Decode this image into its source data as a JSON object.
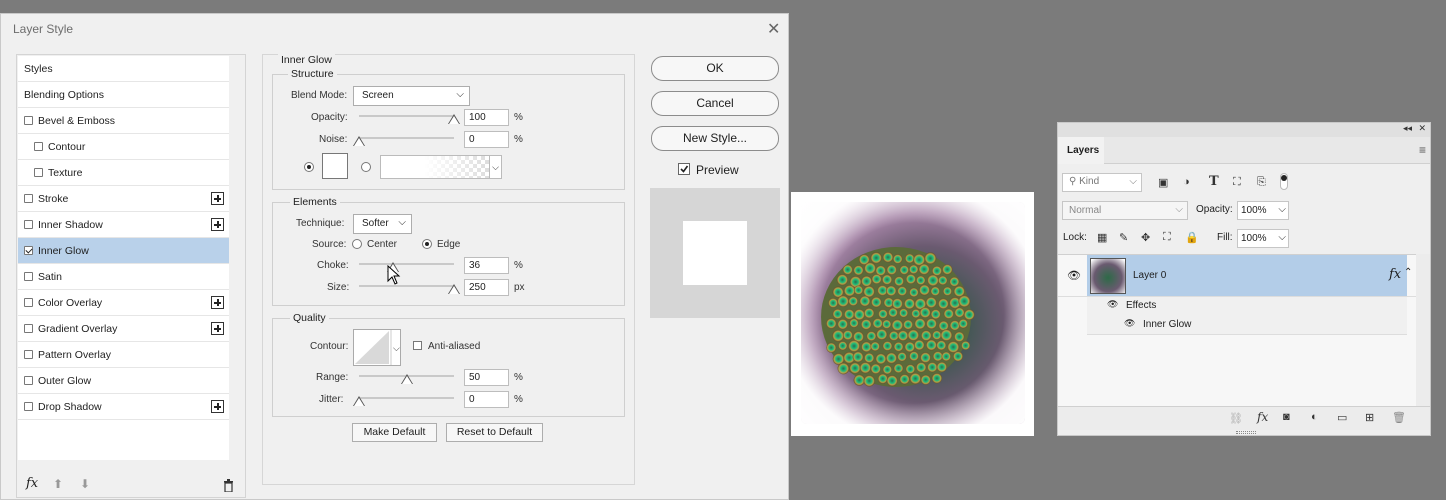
{
  "dialog": {
    "title": "Layer Style",
    "close_glyph": "✕",
    "styles_list": [
      {
        "label": "Styles",
        "checkbox": false,
        "checked": false,
        "plus": false,
        "indent": false
      },
      {
        "label": "Blending Options",
        "checkbox": false,
        "checked": false,
        "plus": false,
        "indent": false
      },
      {
        "label": "Bevel & Emboss",
        "checkbox": true,
        "checked": false,
        "plus": false,
        "indent": false
      },
      {
        "label": "Contour",
        "checkbox": true,
        "checked": false,
        "plus": false,
        "indent": true
      },
      {
        "label": "Texture",
        "checkbox": true,
        "checked": false,
        "plus": false,
        "indent": true
      },
      {
        "label": "Stroke",
        "checkbox": true,
        "checked": false,
        "plus": true,
        "indent": false
      },
      {
        "label": "Inner Shadow",
        "checkbox": true,
        "checked": false,
        "plus": true,
        "indent": false
      },
      {
        "label": "Inner Glow",
        "checkbox": true,
        "checked": true,
        "plus": false,
        "indent": false,
        "selected": true
      },
      {
        "label": "Satin",
        "checkbox": true,
        "checked": false,
        "plus": false,
        "indent": false
      },
      {
        "label": "Color Overlay",
        "checkbox": true,
        "checked": false,
        "plus": true,
        "indent": false
      },
      {
        "label": "Gradient Overlay",
        "checkbox": true,
        "checked": false,
        "plus": true,
        "indent": false
      },
      {
        "label": "Pattern Overlay",
        "checkbox": true,
        "checked": false,
        "plus": false,
        "indent": false
      },
      {
        "label": "Outer Glow",
        "checkbox": true,
        "checked": false,
        "plus": false,
        "indent": false
      },
      {
        "label": "Drop Shadow",
        "checkbox": true,
        "checked": false,
        "plus": true,
        "indent": false
      }
    ],
    "footer": {
      "fx": "fx",
      "up": "⬆",
      "down": "⬇",
      "trash": "🗑"
    },
    "panel": {
      "title": "Inner Glow",
      "structure": {
        "label": "Structure",
        "blend_mode_label": "Blend Mode:",
        "blend_mode_value": "Screen",
        "opacity_label": "Opacity:",
        "opacity_value": "100",
        "opacity_level": 1.0,
        "opacity_unit": "%",
        "noise_label": "Noise:",
        "noise_value": "0",
        "noise_level": 0.0,
        "noise_unit": "%"
      },
      "elements": {
        "label": "Elements",
        "technique_label": "Technique:",
        "technique_value": "Softer",
        "source_label": "Source:",
        "source_center": "Center",
        "source_edge": "Edge",
        "choke_label": "Choke:",
        "choke_value": "36",
        "choke_level": 0.36,
        "choke_unit": "%",
        "size_label": "Size:",
        "size_value": "250",
        "size_level": 1.0,
        "size_unit": "px"
      },
      "quality": {
        "label": "Quality",
        "contour_label": "Contour:",
        "anti_aliased_label": "Anti-aliased",
        "range_label": "Range:",
        "range_value": "50",
        "range_level": 0.5,
        "range_unit": "%",
        "jitter_label": "Jitter:",
        "jitter_value": "0",
        "jitter_level": 0.0,
        "jitter_unit": "%"
      },
      "make_default": "Make Default",
      "reset_default": "Reset to Default"
    },
    "buttons": {
      "ok": "OK",
      "cancel": "Cancel",
      "new_style": "New Style...",
      "preview": "Preview"
    }
  },
  "layers_panel": {
    "title": "Layers",
    "filter_kind": "Kind",
    "blend_mode": "Normal",
    "opacity_label": "Opacity:",
    "opacity_value": "100%",
    "lock_label": "Lock:",
    "fill_label": "Fill:",
    "fill_value": "100%",
    "layer_name": "Layer 0",
    "fx_badge": "fx",
    "effects_label": "Effects",
    "effect_item": "Inner Glow"
  },
  "colors": {
    "selection": "#b9d1ea",
    "dialog_bg": "#f0f0f0",
    "canvas_bg": "#7b7b7b",
    "layer_selected": "#b3cde8"
  }
}
